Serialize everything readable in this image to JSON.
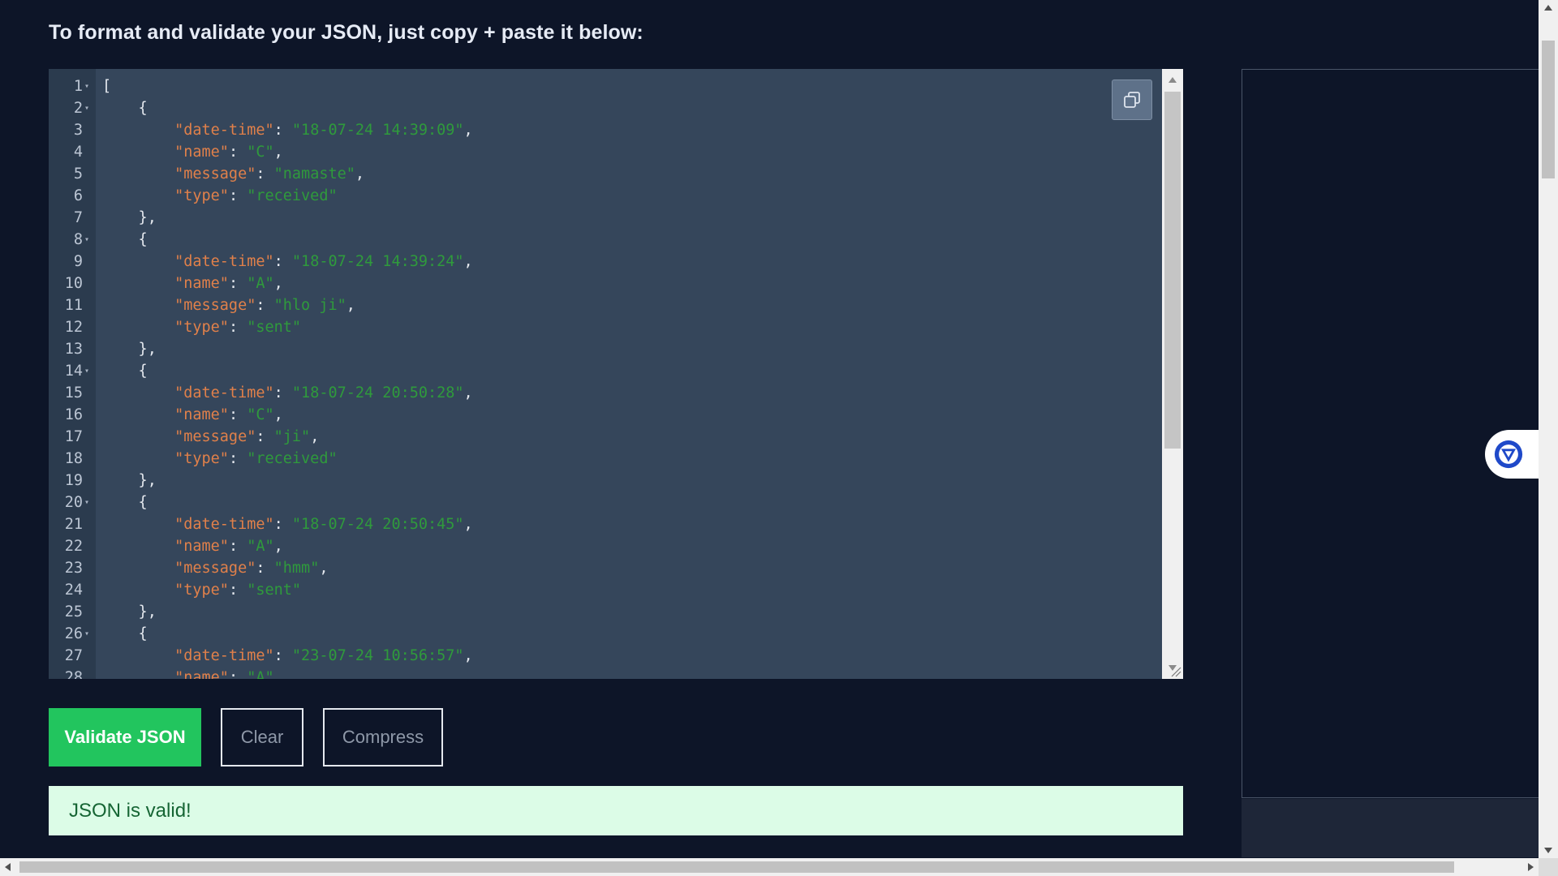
{
  "page": {
    "heading": "To format and validate your JSON, just copy + paste it below:"
  },
  "editor": {
    "lines": [
      {
        "n": "1",
        "fold": true,
        "parts": [
          [
            "p",
            "["
          ]
        ]
      },
      {
        "n": "2",
        "fold": true,
        "parts": [
          [
            "p",
            "    {"
          ]
        ]
      },
      {
        "n": "3",
        "parts": [
          [
            "p",
            "        "
          ],
          [
            "k",
            "\"date-time\""
          ],
          [
            "p",
            ": "
          ],
          [
            "s",
            "\"18-07-24 14:39:09\""
          ],
          [
            "p",
            ","
          ]
        ]
      },
      {
        "n": "4",
        "parts": [
          [
            "p",
            "        "
          ],
          [
            "k",
            "\"name\""
          ],
          [
            "p",
            ": "
          ],
          [
            "s",
            "\"C\""
          ],
          [
            "p",
            ","
          ]
        ]
      },
      {
        "n": "5",
        "parts": [
          [
            "p",
            "        "
          ],
          [
            "k",
            "\"message\""
          ],
          [
            "p",
            ": "
          ],
          [
            "s",
            "\"namaste\""
          ],
          [
            "p",
            ","
          ]
        ]
      },
      {
        "n": "6",
        "parts": [
          [
            "p",
            "        "
          ],
          [
            "k",
            "\"type\""
          ],
          [
            "p",
            ": "
          ],
          [
            "s",
            "\"received\""
          ]
        ]
      },
      {
        "n": "7",
        "parts": [
          [
            "p",
            "    },"
          ]
        ]
      },
      {
        "n": "8",
        "fold": true,
        "parts": [
          [
            "p",
            "    {"
          ]
        ]
      },
      {
        "n": "9",
        "parts": [
          [
            "p",
            "        "
          ],
          [
            "k",
            "\"date-time\""
          ],
          [
            "p",
            ": "
          ],
          [
            "s",
            "\"18-07-24 14:39:24\""
          ],
          [
            "p",
            ","
          ]
        ]
      },
      {
        "n": "10",
        "parts": [
          [
            "p",
            "        "
          ],
          [
            "k",
            "\"name\""
          ],
          [
            "p",
            ": "
          ],
          [
            "s",
            "\"A\""
          ],
          [
            "p",
            ","
          ]
        ]
      },
      {
        "n": "11",
        "parts": [
          [
            "p",
            "        "
          ],
          [
            "k",
            "\"message\""
          ],
          [
            "p",
            ": "
          ],
          [
            "s",
            "\"hlo ji\""
          ],
          [
            "p",
            ","
          ]
        ]
      },
      {
        "n": "12",
        "parts": [
          [
            "p",
            "        "
          ],
          [
            "k",
            "\"type\""
          ],
          [
            "p",
            ": "
          ],
          [
            "s",
            "\"sent\""
          ]
        ]
      },
      {
        "n": "13",
        "parts": [
          [
            "p",
            "    },"
          ]
        ]
      },
      {
        "n": "14",
        "fold": true,
        "parts": [
          [
            "p",
            "    {"
          ]
        ]
      },
      {
        "n": "15",
        "parts": [
          [
            "p",
            "        "
          ],
          [
            "k",
            "\"date-time\""
          ],
          [
            "p",
            ": "
          ],
          [
            "s",
            "\"18-07-24 20:50:28\""
          ],
          [
            "p",
            ","
          ]
        ]
      },
      {
        "n": "16",
        "parts": [
          [
            "p",
            "        "
          ],
          [
            "k",
            "\"name\""
          ],
          [
            "p",
            ": "
          ],
          [
            "s",
            "\"C\""
          ],
          [
            "p",
            ","
          ]
        ]
      },
      {
        "n": "17",
        "parts": [
          [
            "p",
            "        "
          ],
          [
            "k",
            "\"message\""
          ],
          [
            "p",
            ": "
          ],
          [
            "s",
            "\"ji\""
          ],
          [
            "p",
            ","
          ]
        ]
      },
      {
        "n": "18",
        "parts": [
          [
            "p",
            "        "
          ],
          [
            "k",
            "\"type\""
          ],
          [
            "p",
            ": "
          ],
          [
            "s",
            "\"received\""
          ]
        ]
      },
      {
        "n": "19",
        "parts": [
          [
            "p",
            "    },"
          ]
        ]
      },
      {
        "n": "20",
        "fold": true,
        "parts": [
          [
            "p",
            "    {"
          ]
        ]
      },
      {
        "n": "21",
        "parts": [
          [
            "p",
            "        "
          ],
          [
            "k",
            "\"date-time\""
          ],
          [
            "p",
            ": "
          ],
          [
            "s",
            "\"18-07-24 20:50:45\""
          ],
          [
            "p",
            ","
          ]
        ]
      },
      {
        "n": "22",
        "parts": [
          [
            "p",
            "        "
          ],
          [
            "k",
            "\"name\""
          ],
          [
            "p",
            ": "
          ],
          [
            "s",
            "\"A\""
          ],
          [
            "p",
            ","
          ]
        ]
      },
      {
        "n": "23",
        "parts": [
          [
            "p",
            "        "
          ],
          [
            "k",
            "\"message\""
          ],
          [
            "p",
            ": "
          ],
          [
            "s",
            "\"hmm\""
          ],
          [
            "p",
            ","
          ]
        ]
      },
      {
        "n": "24",
        "parts": [
          [
            "p",
            "        "
          ],
          [
            "k",
            "\"type\""
          ],
          [
            "p",
            ": "
          ],
          [
            "s",
            "\"sent\""
          ]
        ]
      },
      {
        "n": "25",
        "parts": [
          [
            "p",
            "    },"
          ]
        ]
      },
      {
        "n": "26",
        "fold": true,
        "parts": [
          [
            "p",
            "    {"
          ]
        ]
      },
      {
        "n": "27",
        "parts": [
          [
            "p",
            "        "
          ],
          [
            "k",
            "\"date-time\""
          ],
          [
            "p",
            ": "
          ],
          [
            "s",
            "\"23-07-24 10:56:57\""
          ],
          [
            "p",
            ","
          ]
        ]
      },
      {
        "n": "28",
        "parts": [
          [
            "p",
            "        "
          ],
          [
            "k",
            "\"name\""
          ],
          [
            "p",
            ": "
          ],
          [
            "s",
            "\"A\""
          ],
          [
            "p",
            ","
          ]
        ]
      }
    ],
    "copy_icon": "copy-icon"
  },
  "actions": {
    "validate_label": "Validate JSON",
    "clear_label": "Clear",
    "compress_label": "Compress"
  },
  "result": {
    "message": "JSON is valid!"
  },
  "colors": {
    "background": "#0d1528",
    "editor_bg": "#35465b",
    "key": "#e0804a",
    "string": "#2f9a3c",
    "validate_button": "#22c55e",
    "result_bg": "#dcfce7"
  }
}
